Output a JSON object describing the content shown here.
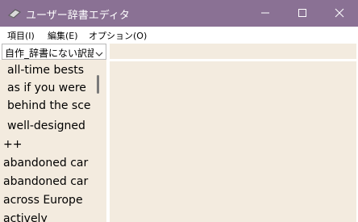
{
  "window": {
    "title": "ユーザー辞書エディタ",
    "colors": {
      "titlebar": "#8a7194",
      "panel": "#f3ebdf"
    }
  },
  "menu": {
    "items": [
      {
        "label": "項目(I)"
      },
      {
        "label": "編集(E)"
      },
      {
        "label": "オプション(O)"
      }
    ]
  },
  "dictionary_select": {
    "value": "自作_辞書にない訳語"
  },
  "entries": [
    "all-time bests",
    "as if you were",
    "behind the sce",
    "well-designed",
    "++",
    "abandoned car",
    "abandoned car",
    "across Europe",
    "actively"
  ],
  "icons": {
    "app": "book-icon",
    "minimize": "minimize-icon",
    "maximize": "maximize-icon",
    "close": "close-icon",
    "dropdown": "chevron-down-icon"
  }
}
